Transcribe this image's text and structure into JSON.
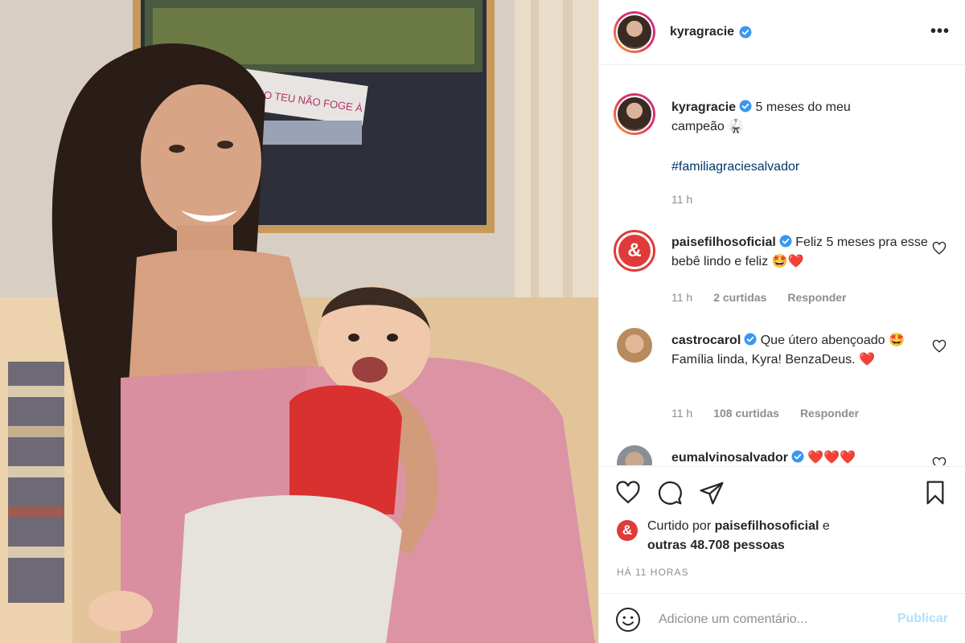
{
  "header": {
    "username": "kyragracie",
    "more": "•••"
  },
  "caption": {
    "username": "kyragracie",
    "text_line1": "5 meses do meu",
    "text_line2": "campeão 🥋",
    "hashtag": "#familiagraciesalvador",
    "time": "11 h"
  },
  "comments": [
    {
      "username": "paisefilhosoficial",
      "text": "Feliz 5 meses pra esse bebê lindo e feliz 🤩❤️",
      "time": "11 h",
      "likes": "2 curtidas",
      "reply": "Responder"
    },
    {
      "username": "castrocarol",
      "text": "Que útero abençoado 🤩 Família linda, Kyra! BenzaDeus. ❤️",
      "time": "11 h",
      "likes": "108 curtidas",
      "reply": "Responder"
    },
    {
      "username": "eumalvinosalvador",
      "text": "❤️❤️❤️"
    }
  ],
  "likes": {
    "avatar_letter": "&",
    "prefix": "Curtido por",
    "user": "paisefilhosoficial",
    "middle": "e",
    "others": "outras 48.708 pessoas"
  },
  "time_ago": "HÁ 11 HORAS",
  "composer": {
    "placeholder": "Adicione um comentário...",
    "publish": "Publicar"
  },
  "photo": {
    "poster_text": "FILHO TEU NÃO FOGE À"
  },
  "colors": {
    "verified": "#3897f0",
    "hashtag": "#00376b",
    "meta": "#8e8e8e",
    "publish_disabled": "#b2dffc",
    "brand_red": "#e03a3a"
  },
  "icons": [
    "verified-icon",
    "more-icon",
    "heart-icon",
    "comment-icon",
    "share-icon",
    "bookmark-icon",
    "emoji-icon"
  ]
}
